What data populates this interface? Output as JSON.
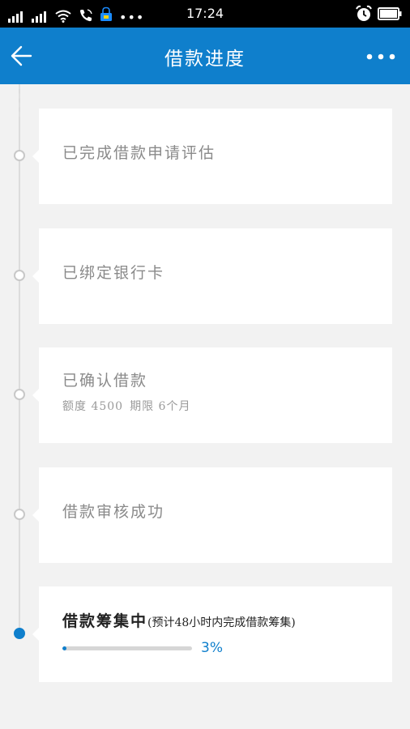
{
  "status_bar": {
    "time": "17:24",
    "sim1_label": "",
    "sim2_label": "",
    "icons": [
      "signal-icon",
      "signal-icon",
      "wifi-icon",
      "phone-call-icon",
      "lock-notification-icon",
      "more-dots-icon",
      "alarm-icon",
      "battery-icon"
    ]
  },
  "app_bar": {
    "title": "借款进度",
    "back_icon": "arrow-left-icon",
    "more_icon": "more-horizontal-icon",
    "color": "#0f7fcc"
  },
  "steps": [
    {
      "title": "已完成借款申请评估",
      "status": "done"
    },
    {
      "title": "已绑定银行卡",
      "status": "done"
    },
    {
      "title": "已确认借款",
      "status": "done",
      "amount_label": "额度 4500",
      "term_label": "期限 6个月"
    },
    {
      "title": "借款审核成功",
      "status": "done"
    },
    {
      "title": "借款筹集中",
      "note": "(预计48小时内完成借款筹集)",
      "status": "active",
      "progress_label": "3%",
      "progress_fraction": 0.03
    }
  ],
  "colors": {
    "accent": "#0f7fcc",
    "done_text": "#8a8a8a",
    "active_text": "#222222"
  }
}
